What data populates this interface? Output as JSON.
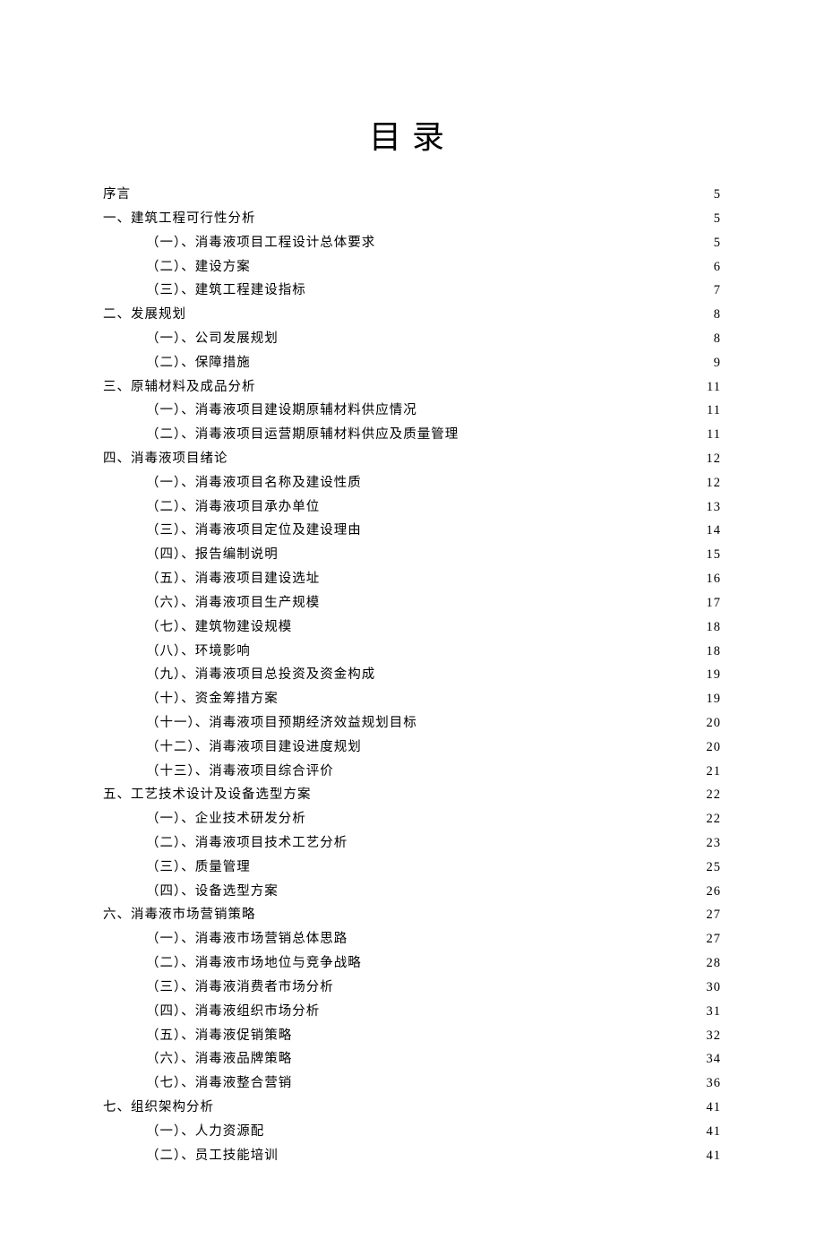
{
  "title": "目录",
  "toc": [
    {
      "level": 1,
      "title": "序言",
      "page": "5"
    },
    {
      "level": 1,
      "title": "一、建筑工程可行性分析",
      "page": "5"
    },
    {
      "level": 2,
      "title": "（一）、消毒液项目工程设计总体要求",
      "page": "5"
    },
    {
      "level": 2,
      "title": "（二）、建设方案",
      "page": "6"
    },
    {
      "level": 2,
      "title": "（三）、建筑工程建设指标",
      "page": "7"
    },
    {
      "level": 1,
      "title": "二、发展规划",
      "page": "8"
    },
    {
      "level": 2,
      "title": "（一）、公司发展规划",
      "page": "8"
    },
    {
      "level": 2,
      "title": "（二）、保障措施",
      "page": "9"
    },
    {
      "level": 1,
      "title": "三、原辅材料及成品分析",
      "page": "11"
    },
    {
      "level": 2,
      "title": "（一）、消毒液项目建设期原辅材料供应情况",
      "page": "11"
    },
    {
      "level": 2,
      "title": "（二）、消毒液项目运营期原辅材料供应及质量管理",
      "page": "11"
    },
    {
      "level": 1,
      "title": "四、消毒液项目绪论",
      "page": "12"
    },
    {
      "level": 2,
      "title": "（一）、消毒液项目名称及建设性质",
      "page": "12"
    },
    {
      "level": 2,
      "title": "（二）、消毒液项目承办单位",
      "page": "13"
    },
    {
      "level": 2,
      "title": "（三）、消毒液项目定位及建设理由",
      "page": "14"
    },
    {
      "level": 2,
      "title": "（四）、报告编制说明",
      "page": "15"
    },
    {
      "level": 2,
      "title": "（五）、消毒液项目建设选址",
      "page": "16"
    },
    {
      "level": 2,
      "title": "（六）、消毒液项目生产规模",
      "page": "17"
    },
    {
      "level": 2,
      "title": "（七）、建筑物建设规模",
      "page": "18"
    },
    {
      "level": 2,
      "title": "（八）、环境影响",
      "page": "18"
    },
    {
      "level": 2,
      "title": "（九）、消毒液项目总投资及资金构成",
      "page": "19"
    },
    {
      "level": 2,
      "title": "（十）、资金筹措方案",
      "page": "19"
    },
    {
      "level": 2,
      "title": "（十一）、消毒液项目预期经济效益规划目标",
      "page": "20"
    },
    {
      "level": 2,
      "title": "（十二）、消毒液项目建设进度规划",
      "page": "20"
    },
    {
      "level": 2,
      "title": "（十三）、消毒液项目综合评价",
      "page": "21"
    },
    {
      "level": 1,
      "title": "五、工艺技术设计及设备选型方案",
      "page": "22"
    },
    {
      "level": 2,
      "title": "（一）、企业技术研发分析",
      "page": "22"
    },
    {
      "level": 2,
      "title": "（二）、消毒液项目技术工艺分析",
      "page": "23"
    },
    {
      "level": 2,
      "title": "（三）、质量管理",
      "page": "25"
    },
    {
      "level": 2,
      "title": "（四）、设备选型方案",
      "page": "26"
    },
    {
      "level": 1,
      "title": "六、消毒液市场营销策略",
      "page": "27"
    },
    {
      "level": 2,
      "title": "（一）、消毒液市场营销总体思路",
      "page": "27"
    },
    {
      "level": 2,
      "title": "（二）、消毒液市场地位与竞争战略",
      "page": "28"
    },
    {
      "level": 2,
      "title": "（三）、消毒液消费者市场分析",
      "page": "30"
    },
    {
      "level": 2,
      "title": "（四）、消毒液组织市场分析",
      "page": "31"
    },
    {
      "level": 2,
      "title": "（五）、消毒液促销策略",
      "page": "32"
    },
    {
      "level": 2,
      "title": "（六）、消毒液品牌策略",
      "page": "34"
    },
    {
      "level": 2,
      "title": "（七）、消毒液整合营销",
      "page": "36"
    },
    {
      "level": 1,
      "title": "七、组织架构分析",
      "page": "41"
    },
    {
      "level": 2,
      "title": "（一）、人力资源配",
      "page": "41"
    },
    {
      "level": 2,
      "title": "（二）、员工技能培训",
      "page": "41"
    }
  ]
}
